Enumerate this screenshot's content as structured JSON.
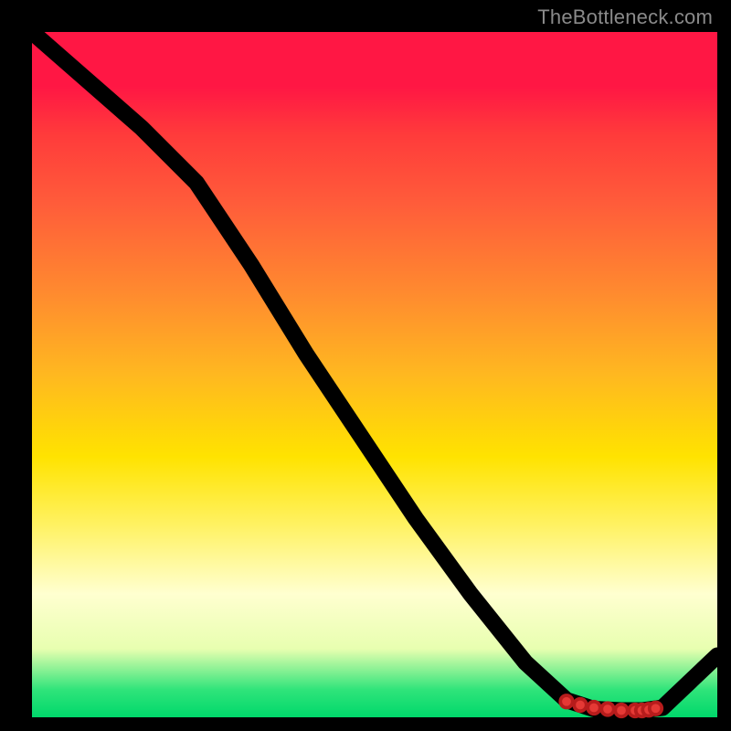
{
  "watermark": "TheBottleneck.com",
  "chart_data": {
    "type": "line",
    "title": "",
    "xlabel": "",
    "ylabel": "",
    "xlim": [
      0,
      100
    ],
    "ylim": [
      0,
      100
    ],
    "grid": false,
    "series": [
      {
        "name": "curve",
        "x": [
          0,
          8,
          16,
          24,
          32,
          40,
          48,
          56,
          64,
          72,
          78,
          82,
          86,
          89,
          92,
          100
        ],
        "values": [
          100,
          93,
          86,
          78,
          66,
          53,
          41,
          29,
          18,
          8,
          2.5,
          1.2,
          1.0,
          1.0,
          1.4,
          9
        ]
      }
    ],
    "markers": {
      "name": "highlighted-points",
      "x": [
        78,
        80,
        82,
        84,
        86,
        88,
        89,
        90,
        91
      ],
      "values": [
        2.3,
        1.8,
        1.4,
        1.2,
        1.0,
        1.0,
        1.0,
        1.1,
        1.3
      ]
    }
  }
}
